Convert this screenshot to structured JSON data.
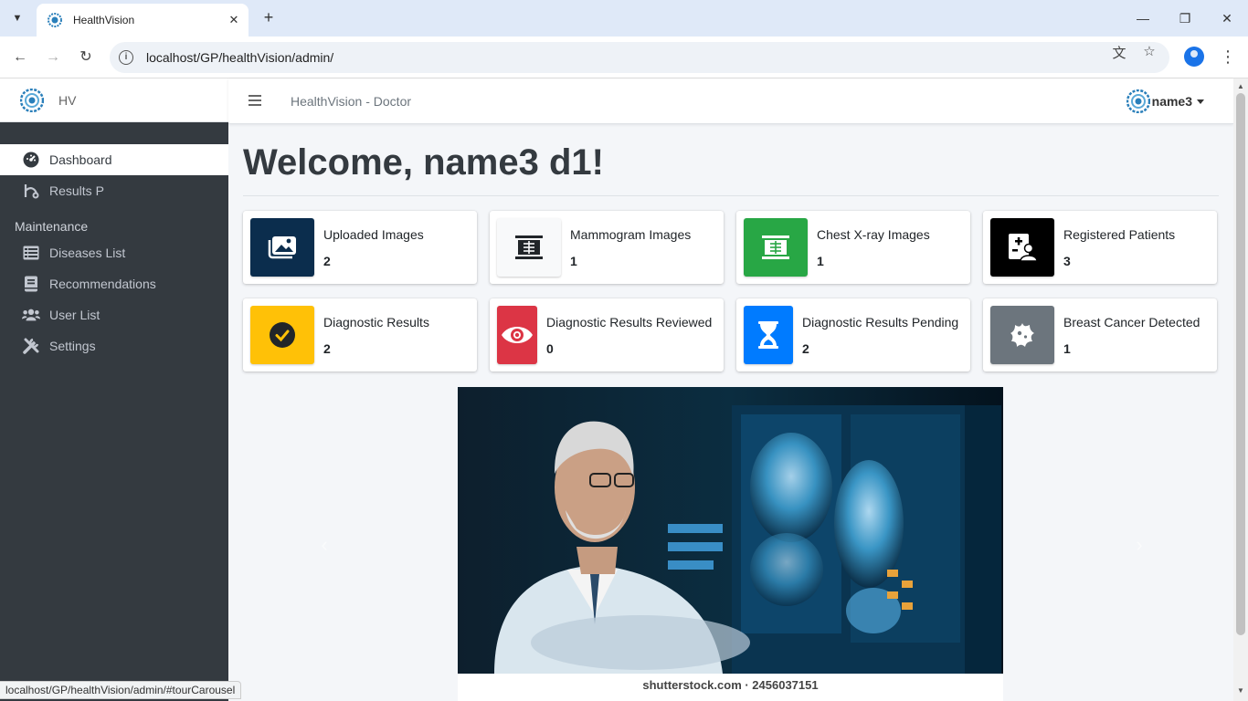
{
  "browser": {
    "tab_title": "HealthVision",
    "url": "localhost/GP/healthVision/admin/",
    "status_url": "localhost/GP/healthVision/admin/#tourCarousel"
  },
  "sidebar": {
    "brand": "HV",
    "items": [
      {
        "label": "Dashboard",
        "icon": "dashboard-icon",
        "active": true
      },
      {
        "label": "Results P",
        "icon": "x-ray-icon"
      }
    ],
    "section_header": "Maintenance",
    "maintenance_items": [
      {
        "label": "Diseases List",
        "icon": "table-list-icon"
      },
      {
        "label": "Recommendations",
        "icon": "book-icon"
      },
      {
        "label": "User List",
        "icon": "users-icon"
      },
      {
        "label": "Settings",
        "icon": "tools-icon"
      }
    ]
  },
  "topnav": {
    "title": "HealthVision - Doctor",
    "username": "name3"
  },
  "main": {
    "welcome": "Welcome, name3 d1!",
    "cards": [
      {
        "label": "Uploaded Images",
        "value": "2",
        "color": "#0a2a4a",
        "icon": "images-icon"
      },
      {
        "label": "Mammogram Images",
        "value": "1",
        "color": "#f8f9fa",
        "icon": "x-ray-icon"
      },
      {
        "label": "Chest X-ray Images",
        "value": "1",
        "color": "#28a745",
        "icon": "x-ray-icon"
      },
      {
        "label": "Registered Patients",
        "value": "3",
        "color": "#000000",
        "icon": "patient-file-icon"
      },
      {
        "label": "Diagnostic Results",
        "value": "2",
        "color": "#ffc107",
        "icon": "check-circle-icon"
      },
      {
        "label": "Diagnostic Results Reviewed",
        "value": "0",
        "color": "#dc3545",
        "icon": "eye-icon"
      },
      {
        "label": "Diagnostic Results Pending",
        "value": "2",
        "color": "#007bff",
        "icon": "hourglass-icon"
      },
      {
        "label": "Breast Cancer Detected",
        "value": "1",
        "color": "#6c757d",
        "icon": "virus-icon"
      }
    ]
  },
  "carousel": {
    "caption": "shutterstock.com · 2456037151"
  }
}
